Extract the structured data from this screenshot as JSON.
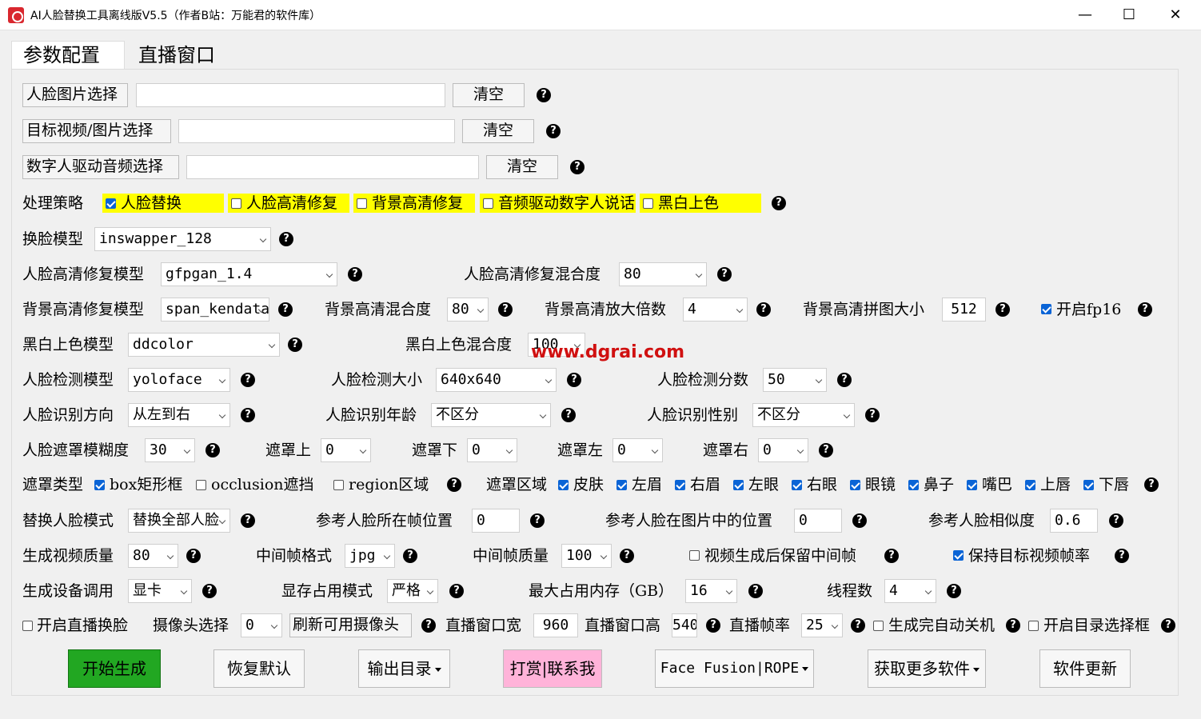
{
  "window": {
    "title": "AI人脸替换工具离线版V5.5（作者B站：万能君的软件库）",
    "min": "—",
    "max": "☐",
    "close": "✕"
  },
  "tabs": [
    "参数配置",
    "直播窗口"
  ],
  "q": "?",
  "files": {
    "face": {
      "label": "人脸图片选择",
      "clear": "清空"
    },
    "target": {
      "label": "目标视频/图片选择",
      "clear": "清空"
    },
    "audio": {
      "label": "数字人驱动音频选择",
      "clear": "清空"
    }
  },
  "strategy": {
    "label": "处理策略",
    "opts": [
      "人脸替换",
      "人脸高清修复",
      "背景高清修复",
      "音频驱动数字人说话",
      "黑白上色"
    ]
  },
  "swap_model": {
    "label": "换脸模型",
    "value": "inswapper_128"
  },
  "face_enh": {
    "label": "人脸高清修复模型",
    "value": "gfpgan_1.4",
    "blend_label": "人脸高清修复混合度",
    "blend": "80"
  },
  "bg_enh": {
    "label": "背景高清修复模型",
    "value": "span_kendata",
    "blend_label": "背景高清混合度",
    "blend": "80",
    "scale_label": "背景高清放大倍数",
    "scale": "4",
    "tile_label": "背景高清拼图大小",
    "tile": "512",
    "fp16": "开启fp16"
  },
  "color": {
    "label": "黑白上色模型",
    "value": "ddcolor",
    "blend_label": "黑白上色混合度",
    "blend": "100"
  },
  "detect": {
    "model_label": "人脸检测模型",
    "model": "yoloface",
    "size_label": "人脸检测大小",
    "size": "640x640",
    "score_label": "人脸检测分数",
    "score": "50"
  },
  "recog": {
    "dir_label": "人脸识别方向",
    "dir": "从左到右",
    "age_label": "人脸识别年龄",
    "age": "不区分",
    "gender_label": "人脸识别性别",
    "gender": "不区分"
  },
  "mask": {
    "blur_label": "人脸遮罩模糊度",
    "blur": "30",
    "top_label": "遮罩上",
    "top": "0",
    "bottom_label": "遮罩下",
    "bottom": "0",
    "left_label": "遮罩左",
    "left": "0",
    "right_label": "遮罩右",
    "right": "0"
  },
  "mask_type": {
    "label": "遮罩类型",
    "opts": [
      "box矩形框",
      "occlusion遮挡",
      "region区域"
    ],
    "area_label": "遮罩区域",
    "areas": [
      "皮肤",
      "左眉",
      "右眉",
      "左眼",
      "右眼",
      "眼镜",
      "鼻子",
      "嘴巴",
      "上唇",
      "下唇"
    ]
  },
  "replace": {
    "mode_label": "替换人脸模式",
    "mode": "替换全部人脸",
    "frame_label": "参考人脸所在帧位置",
    "frame": "0",
    "pos_label": "参考人脸在图片中的位置",
    "pos": "0",
    "sim_label": "参考人脸相似度",
    "sim": "0.6"
  },
  "video": {
    "quality_label": "生成视频质量",
    "quality": "80",
    "fmt_label": "中间帧格式",
    "fmt": "jpg",
    "fq_label": "中间帧质量",
    "fq": "100",
    "keep": "视频生成后保留中间帧",
    "fps_keep": "保持目标视频帧率"
  },
  "device": {
    "label": "生成设备调用",
    "value": "显卡",
    "mem_mode_label": "显存占用模式",
    "mem_mode": "严格",
    "mem_label": "最大占用内存（GB）",
    "mem": "16",
    "threads_label": "线程数",
    "threads": "4"
  },
  "live": {
    "enable": "开启直播换脸",
    "cam_label": "摄像头选择",
    "cam": "0",
    "refresh": "刷新可用摄像头",
    "w_label": "直播窗口宽",
    "w": "960",
    "h_label": "直播窗口高",
    "h": "540",
    "fps_label": "直播帧率",
    "fps": "25",
    "auto_close": "生成完自动关机",
    "dir_sel": "开启目录选择框"
  },
  "buttons": {
    "start": "开始生成",
    "reset": "恢复默认",
    "outdir": "输出目录",
    "donate": "打赏|联系我",
    "ff": "Face Fusion|ROPE",
    "more": "获取更多软件",
    "update": "软件更新"
  },
  "watermark": "www.dgrai.com",
  "colors": {
    "start": "#22a722",
    "donate": "#ffb3d9",
    "highlight": "#ffff00",
    "check": "#0a64d6"
  }
}
